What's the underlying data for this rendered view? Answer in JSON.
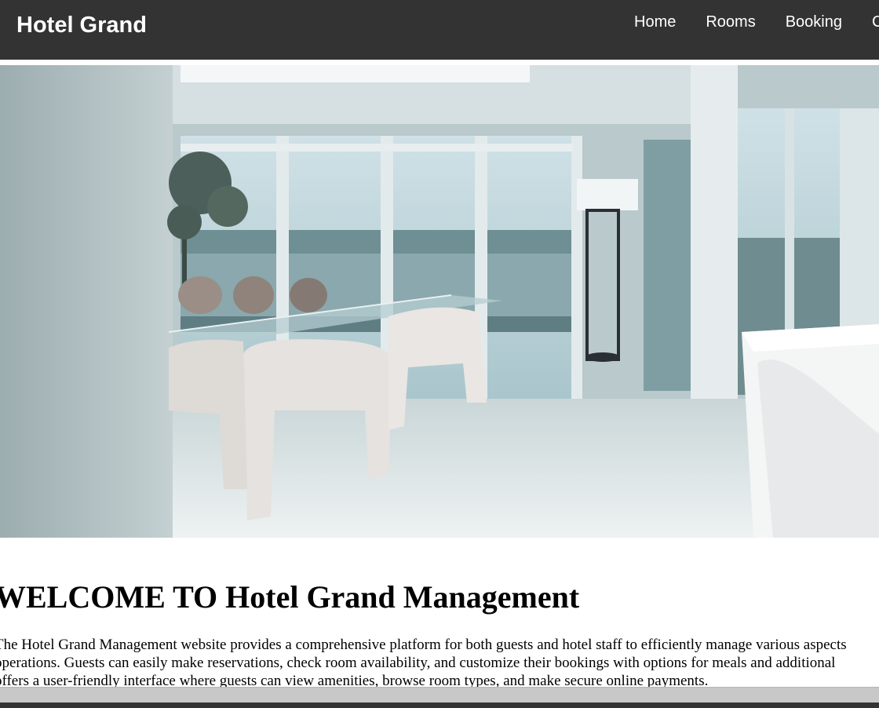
{
  "navbar": {
    "brand": "Hotel Grand",
    "links": [
      "Home",
      "Rooms",
      "Booking",
      "C"
    ]
  },
  "hero": {
    "image_alt": "Hotel dining room with glass table and white chairs overlooking the sea"
  },
  "main": {
    "heading": "WELCOME TO Hotel Grand Management",
    "paragraph_lines": [
      "The Hotel Grand Management website provides a comprehensive platform for both guests and hotel staff to efficiently manage various aspects",
      "operations. Guests can easily make reservations, check room availability, and customize their bookings with options for meals and additional",
      "offers a user-friendly interface where guests can view amenities, browse room types, and make secure online payments."
    ]
  },
  "colors": {
    "navbar_bg": "#333333",
    "nav_text": "#ffffff",
    "body_text": "#000000"
  }
}
